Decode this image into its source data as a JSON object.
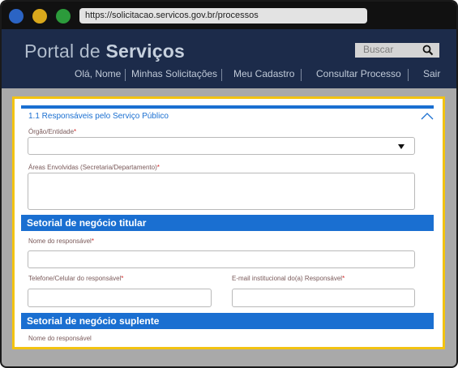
{
  "browser": {
    "url": "https://solicitacao.servicos.gov.br/processos"
  },
  "header": {
    "title_part1": "Portal de ",
    "title_part2": "Serviços",
    "search_placeholder": "Buscar",
    "nav": [
      {
        "label": "Olá, Nome"
      },
      {
        "label": "Minhas Solicitações"
      },
      {
        "label": "Meu Cadastro"
      },
      {
        "label": "Consultar Processo"
      },
      {
        "label": "Sair"
      }
    ]
  },
  "form": {
    "section_title": "1.1 Responsáveis pelo Serviço Público",
    "orgao_label": "Órgão/Entidade",
    "areas_label": "Áreas Envolvidas (Secretaria/Departamento)",
    "titular_heading": "Setorial de negócio titular",
    "titular_nome_label": "Nome do responsável",
    "titular_telefone_label": "Telefone/Celular do responsável",
    "titular_email_label": "E-mail institucional do(a) Responsável",
    "suplente_heading": "Setorial de negócio suplente",
    "suplente_nome_label": "Nome do responsável",
    "required_mark": "*"
  },
  "colors": {
    "header_bg": "#1c2b4a",
    "accent": "#1a6fd1",
    "highlight_border": "#f3c311"
  }
}
